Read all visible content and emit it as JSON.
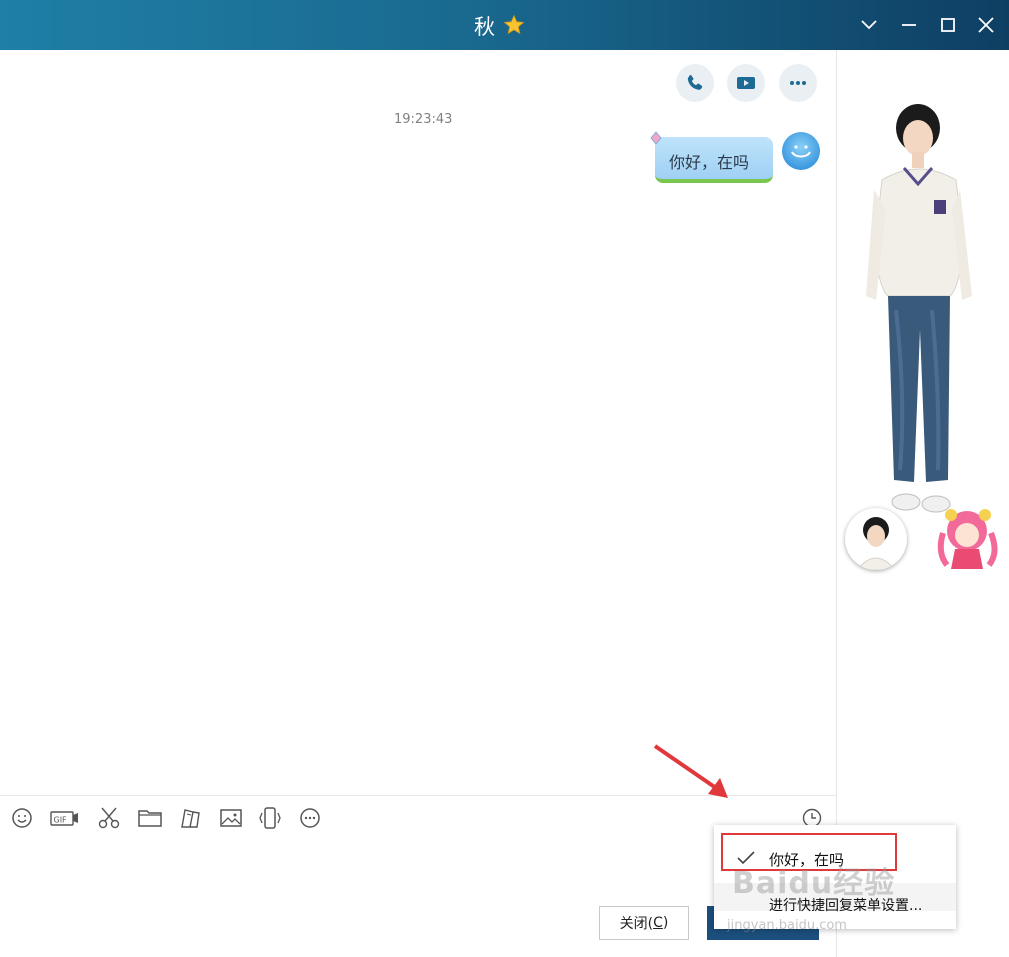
{
  "titlebar": {
    "title": "秋",
    "controls": [
      "chevron-down",
      "minimize",
      "maximize",
      "close"
    ]
  },
  "chat": {
    "actions": [
      "phone-call",
      "video-call",
      "more-options"
    ],
    "timestamp": "19:23:43",
    "messages": [
      {
        "text": "你好，在吗",
        "sender": "self"
      }
    ]
  },
  "toolbar": {
    "tools": [
      "emoji",
      "gif",
      "screenshot-scissors",
      "file-folder",
      "doodle",
      "image",
      "shake",
      "more"
    ],
    "history": "clock"
  },
  "buttons": {
    "close_label": "关闭(",
    "close_key": "C",
    "close_tail": ")",
    "send_label": ""
  },
  "quick_reply_menu": {
    "item_label": "你好，在吗",
    "item_checked": true,
    "settings_label": "进行快捷回复菜单设置..."
  },
  "watermark": {
    "main": "Baidu经验",
    "sub": "jingyan.baidu.com"
  },
  "colors": {
    "titlebar_left": "#1f7fa6",
    "titlebar_right": "#0e3f63",
    "send_button": "#1c4f7d",
    "highlight_border": "#e0383b"
  }
}
